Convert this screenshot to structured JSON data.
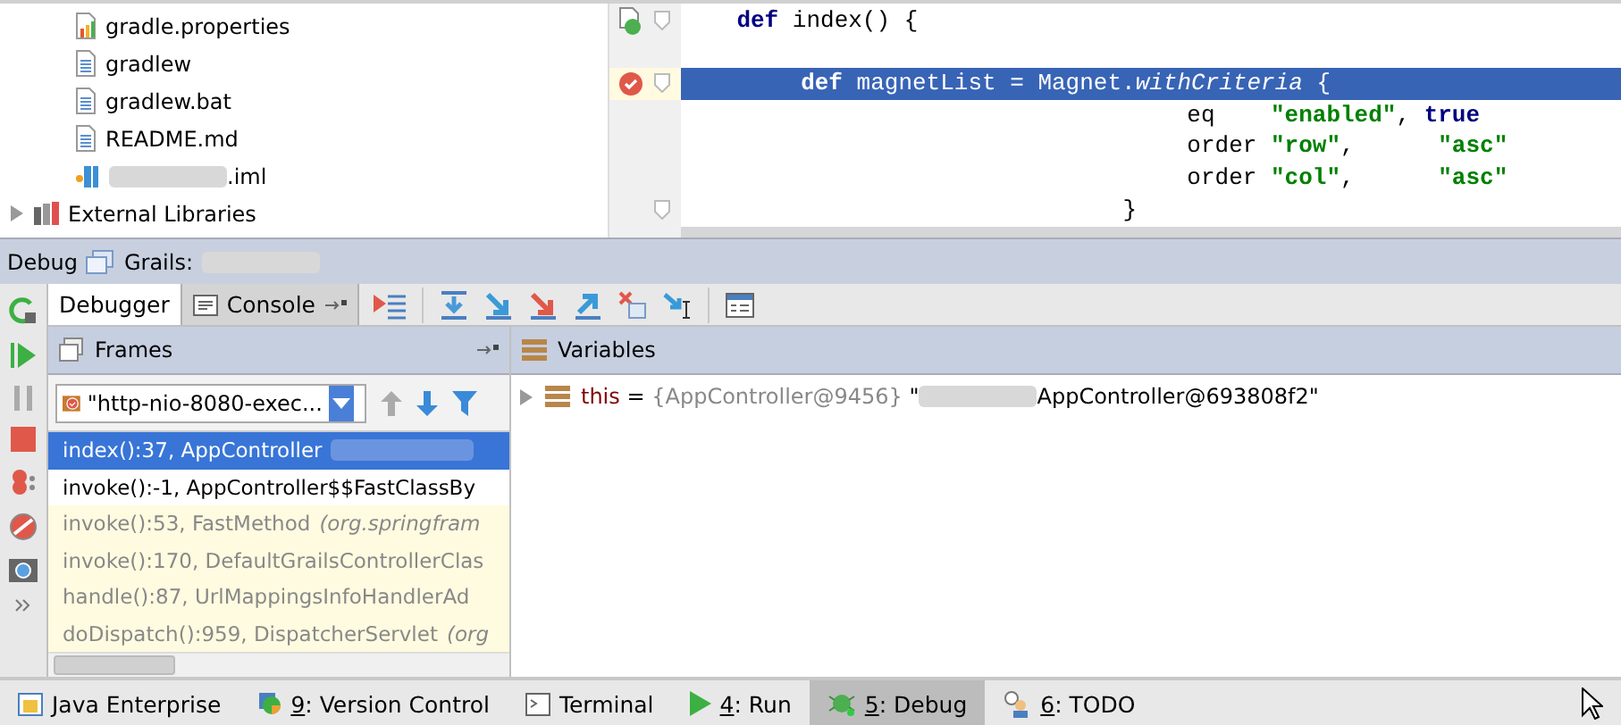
{
  "project_tree": [
    {
      "kind": "properties",
      "label": "gradle.properties"
    },
    {
      "kind": "text",
      "label": "gradlew"
    },
    {
      "kind": "text",
      "label": "gradlew.bat"
    },
    {
      "kind": "text",
      "label": "README.md"
    },
    {
      "kind": "module",
      "label": ".iml",
      "redacted": true
    },
    {
      "kind": "library",
      "label": "External Libraries",
      "expanded": false
    }
  ],
  "editor": {
    "lines": [
      {
        "kind": "method",
        "run_marker": true,
        "breakpoint": false,
        "fold": true,
        "highlighted": false,
        "segments": [
          {
            "kind": "keyword",
            "text": "def"
          },
          {
            "kind": "plain",
            "text": " index() {"
          }
        ]
      },
      {
        "kind": "blank",
        "run_marker": false,
        "breakpoint": false,
        "fold": false,
        "highlighted": false
      },
      {
        "kind": "statement",
        "run_marker": false,
        "breakpoint": true,
        "fold": true,
        "highlighted": true,
        "segments": [
          {
            "kind": "keyword",
            "text": "def"
          },
          {
            "kind": "plain",
            "text": " magnetList = Magnet."
          },
          {
            "kind": "italic",
            "text": "withCriteria"
          },
          {
            "kind": "plain",
            "text": " {"
          }
        ]
      },
      {
        "kind": "argument",
        "run_marker": false,
        "breakpoint": false,
        "fold": false,
        "highlighted": false,
        "segments": [
          {
            "kind": "plain",
            "text": "eq    "
          },
          {
            "kind": "string",
            "text": "\"enabled\""
          },
          {
            "kind": "plain",
            "text": ", "
          },
          {
            "kind": "keyword",
            "text": "true"
          }
        ]
      },
      {
        "kind": "argument",
        "run_marker": false,
        "breakpoint": false,
        "fold": false,
        "highlighted": false,
        "segments": [
          {
            "kind": "plain",
            "text": "order "
          },
          {
            "kind": "string",
            "text": "\"row\""
          },
          {
            "kind": "plain",
            "text": ",      "
          },
          {
            "kind": "string",
            "text": "\"asc\""
          }
        ]
      },
      {
        "kind": "argument",
        "run_marker": false,
        "breakpoint": false,
        "fold": false,
        "highlighted": false,
        "segments": [
          {
            "kind": "plain",
            "text": "order "
          },
          {
            "kind": "string",
            "text": "\"col\""
          },
          {
            "kind": "plain",
            "text": ",      "
          },
          {
            "kind": "string",
            "text": "\"asc\""
          }
        ]
      },
      {
        "kind": "closing",
        "run_marker": false,
        "breakpoint": false,
        "fold": true,
        "highlighted": false,
        "segments": [
          {
            "kind": "plain",
            "text": "}"
          }
        ]
      }
    ]
  },
  "debug": {
    "title": "Debug",
    "config_label": "Grails:",
    "tabs": [
      {
        "label": "Debugger",
        "selected": true
      },
      {
        "label": "Console",
        "selected": false
      }
    ],
    "frames": {
      "title": "Frames",
      "thread": "\"http-nio-8080-exec...",
      "rows": [
        {
          "kind": "user",
          "selected": true,
          "text": "index():37, AppController",
          "redacted": true
        },
        {
          "kind": "user",
          "selected": false,
          "text": "invoke():-1, AppController$$FastClassBy"
        },
        {
          "kind": "library",
          "selected": false,
          "text": "invoke():53, FastMethod",
          "package": "(org.springfram"
        },
        {
          "kind": "library",
          "selected": false,
          "text": "invoke():170, DefaultGrailsControllerClas"
        },
        {
          "kind": "library",
          "selected": false,
          "text": "handle():87, UrlMappingsInfoHandlerAd"
        },
        {
          "kind": "library",
          "selected": false,
          "text": "doDispatch():959, DispatcherServlet",
          "package": "(org"
        }
      ]
    },
    "variables": {
      "title": "Variables",
      "items": [
        {
          "name": "this",
          "expanded": false,
          "operator": "=",
          "type": "{AppController@9456}",
          "value_prefix": "\"",
          "value": "AppController@693808f2\""
        }
      ]
    }
  },
  "status_bar": [
    {
      "kind": "enterprise",
      "label": "Java Enterprise",
      "selected": false
    },
    {
      "kind": "vcs",
      "mnemonic": "9",
      "label": ": Version Control",
      "selected": false
    },
    {
      "kind": "terminal",
      "label": "Terminal",
      "selected": false
    },
    {
      "kind": "run",
      "mnemonic": "4",
      "label": ": Run",
      "selected": false
    },
    {
      "kind": "debug",
      "mnemonic": "5",
      "label": ": Debug",
      "selected": true
    },
    {
      "kind": "todo",
      "mnemonic": "6",
      "label": ": TODO",
      "selected": false
    }
  ]
}
